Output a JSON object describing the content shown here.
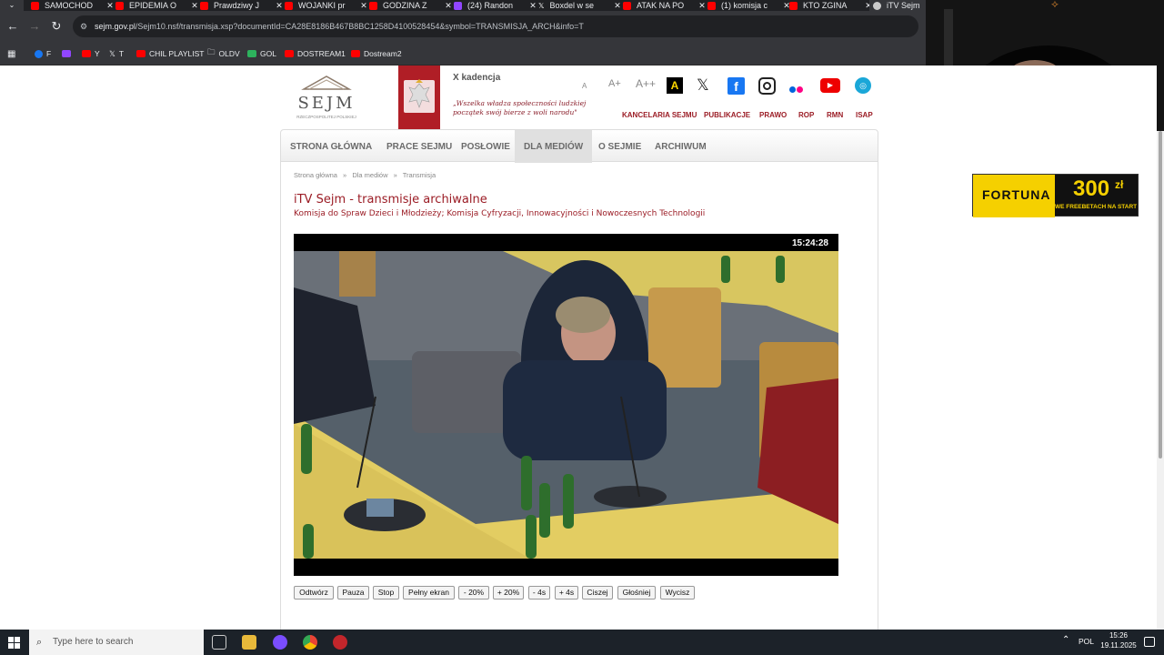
{
  "browser": {
    "tabs": [
      {
        "title": "SAMOCHOD"
      },
      {
        "title": "EPIDEMIA O"
      },
      {
        "title": "Prawdziwy J"
      },
      {
        "title": "WOJANKI pr"
      },
      {
        "title": "GODZINA Z"
      },
      {
        "title": "(24) Randon"
      },
      {
        "title": "Boxdel w se"
      },
      {
        "title": "ATAK NA PO"
      },
      {
        "title": "(1) komisja c"
      },
      {
        "title": "KTO ZGINA"
      },
      {
        "title": "iTV Sejm"
      }
    ],
    "close_glyph": "✕",
    "url_domain": "sejm.gov.pl",
    "url_path": "/Sejm10.nsf/transmisja.xsp?documentId=CA28E8186B467B8BC1258D4100528454&symbol=TRANSMISJA_ARCH&info=T",
    "bookmarks": [
      "F",
      "",
      "Y",
      "T",
      "CHIL PLAYLIST",
      "OLDV",
      "GOL",
      "DOSTREAM1",
      "Dostream2"
    ]
  },
  "header": {
    "logo_text": "SEJM",
    "logo_sub": "RZECZPOSPOLITEJ POLSKIEJ",
    "kadencja": "X kadencja",
    "motto": "„Wszelka władza społeczności ludzkiej początek swój bierze z woli narodu\"",
    "font_controls": [
      "A",
      "A+",
      "A++"
    ],
    "top_links": [
      "KANCELARIA SEJMU",
      "PUBLIKACJE",
      "PRAWO",
      "ROP",
      "RMN",
      "ISAP"
    ]
  },
  "menu": [
    "STRONA GŁÓWNA",
    "PRACE SEJMU",
    "POSŁOWIE",
    "DLA MEDIÓW",
    "O SEJMIE",
    "ARCHIWUM"
  ],
  "breadcrumb": [
    "Strona główna",
    "Dla mediów",
    "Transmisja"
  ],
  "breadcrumb_sep": "»",
  "page": {
    "title": "iTV Sejm - transmisje archiwalne",
    "subtitle": "Komisja do Spraw Dzieci i Młodzieży; Komisja Cyfryzacji, Innowacyjności i Nowoczesnych Technologii"
  },
  "player": {
    "timestamp": "15:24:28",
    "controls": [
      "Odtwórz",
      "Pauza",
      "Stop",
      "Pełny ekran",
      "- 20%",
      "+ 20%",
      "- 4s",
      "+ 4s",
      "Ciszej",
      "Głośniej",
      "Wycisz"
    ]
  },
  "ad": {
    "brand": "FORTUNA",
    "amount": "300",
    "currency": "zł",
    "tagline": "WE FREEBETACH NA START"
  },
  "taskbar": {
    "search_placeholder": "Type here to search",
    "lang": "POL",
    "time": "15:26",
    "date": "19.11.2025"
  },
  "colors": {
    "sejm_red": "#9b1c25",
    "chrome_dark": "#202124",
    "fortuna_yellow": "#f5d000"
  }
}
